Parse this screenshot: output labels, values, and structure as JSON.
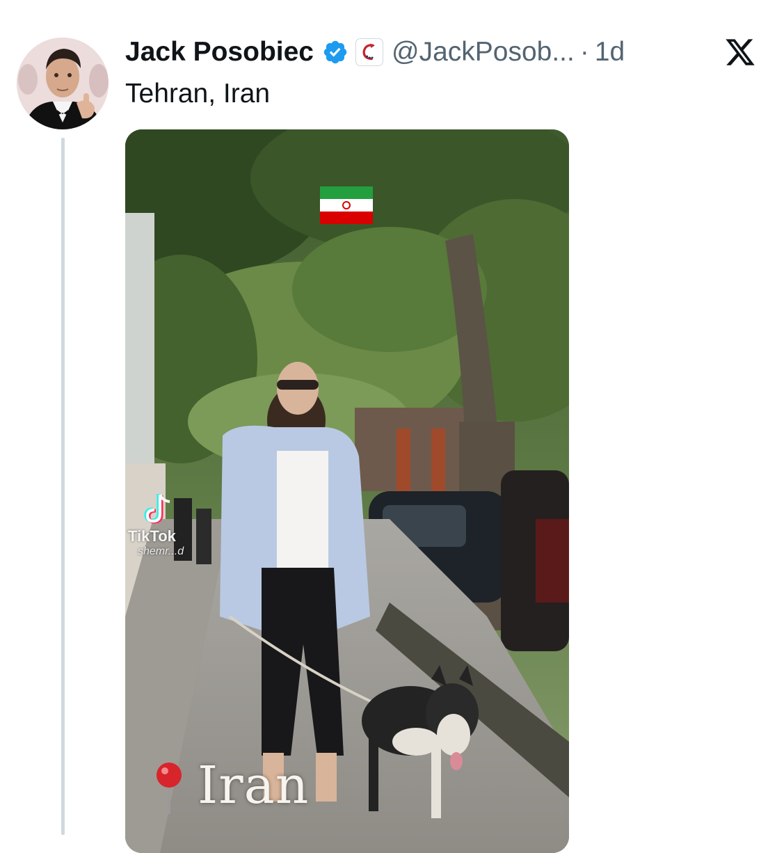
{
  "tweet": {
    "display_name": "Jack Posobiec",
    "handle": "@JackPosob...",
    "separator": "·",
    "time": "1d",
    "text": "Tehran, Iran"
  },
  "icons": {
    "verified": "verified-badge-icon",
    "affiliation": "affiliate-badge-icon",
    "platform": "x-logo-icon"
  },
  "media": {
    "watermark_name": "TikTok",
    "watermark_user": "shemr...d",
    "caption": "Iran",
    "location_marker": "round-pushpin-icon"
  },
  "colors": {
    "verified_blue": "#1d9bf0",
    "secondary_text": "#536471",
    "thread_line": "#cfd9de"
  }
}
